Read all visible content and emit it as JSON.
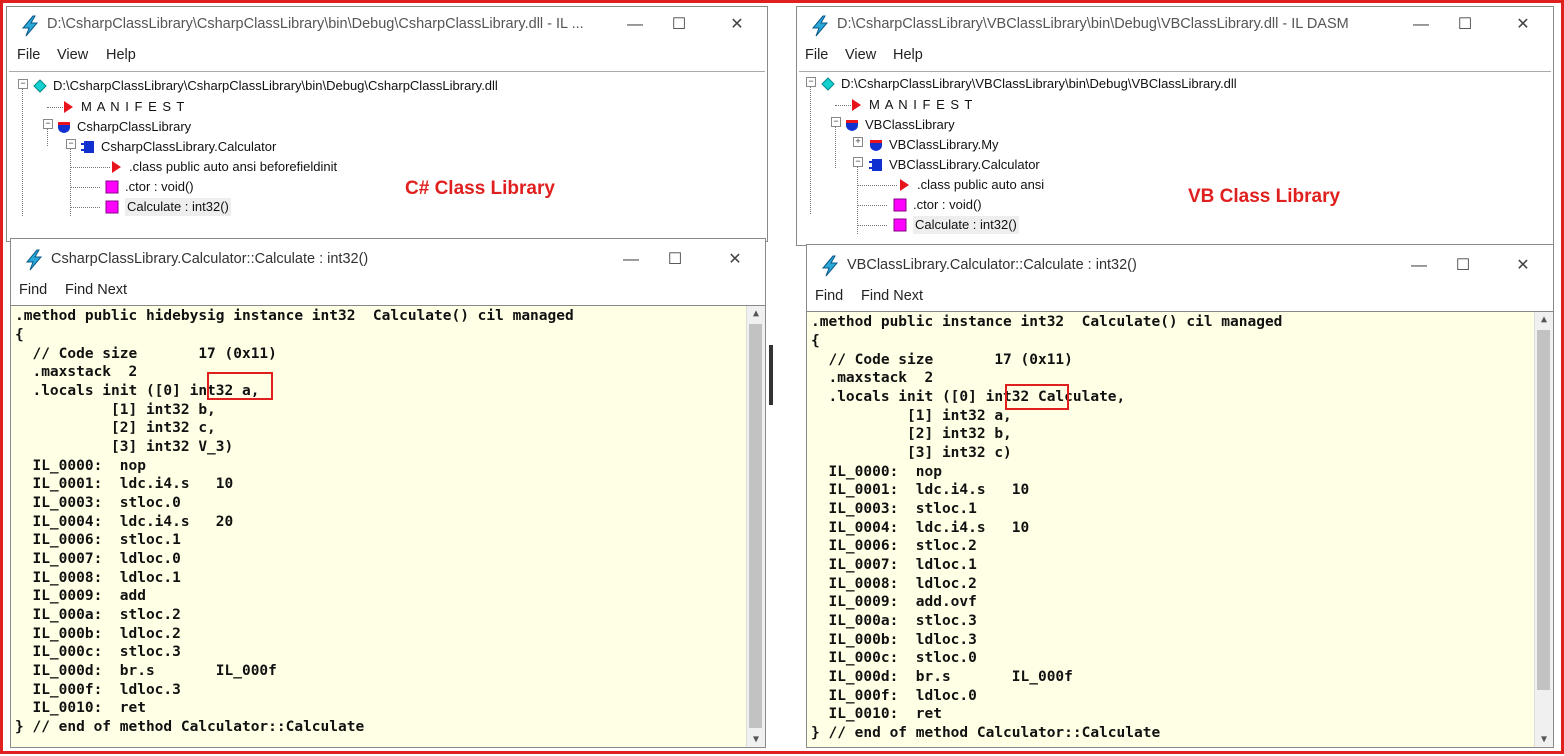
{
  "left": {
    "dasm_title": "D:\\CsharpClassLibrary\\CsharpClassLibrary\\bin\\Debug\\CsharpClassLibrary.dll - IL ...",
    "menu": [
      "File",
      "View",
      "Help"
    ],
    "tree": {
      "root": "D:\\CsharpClassLibrary\\CsharpClassLibrary\\bin\\Debug\\CsharpClassLibrary.dll",
      "manifest": "M A N I F E S T",
      "namespace": "CsharpClassLibrary",
      "class": "CsharpClassLibrary.Calculator",
      "class_decl": ".class public auto ansi beforefieldinit",
      "ctor": ".ctor : void()",
      "method": "Calculate : int32()"
    },
    "annotation": "C# Class Library",
    "code_title": "CsharpClassLibrary.Calculator::Calculate : int32()",
    "code_menu": [
      "Find",
      "Find Next"
    ],
    "code_lines": [
      ".method public hidebysig instance int32  Calculate() cil managed",
      "{",
      "  // Code size       17 (0x11)",
      "  .maxstack  2",
      "  .locals init ([0] int32 a,",
      "           [1] int32 b,",
      "           [2] int32 c,",
      "           [3] int32 V_3)",
      "  IL_0000:  nop",
      "  IL_0001:  ldc.i4.s   10",
      "  IL_0003:  stloc.0",
      "  IL_0004:  ldc.i4.s   20",
      "  IL_0006:  stloc.1",
      "  IL_0007:  ldloc.0",
      "  IL_0008:  ldloc.1",
      "  IL_0009:  add",
      "  IL_000a:  stloc.2",
      "  IL_000b:  ldloc.2",
      "  IL_000c:  stloc.3",
      "  IL_000d:  br.s       IL_000f",
      "  IL_000f:  ldloc.3",
      "  IL_0010:  ret",
      "} // end of method Calculator::Calculate"
    ]
  },
  "right": {
    "dasm_title": "D:\\CsharpClassLibrary\\VBClassLibrary\\bin\\Debug\\VBClassLibrary.dll - IL DASM",
    "menu": [
      "File",
      "View",
      "Help"
    ],
    "tree": {
      "root": "D:\\CsharpClassLibrary\\VBClassLibrary\\bin\\Debug\\VBClassLibrary.dll",
      "manifest": "M A N I F E S T",
      "namespace": "VBClassLibrary",
      "my_ns": "VBClassLibrary.My",
      "class": "VBClassLibrary.Calculator",
      "class_decl": ".class public auto ansi",
      "ctor": ".ctor : void()",
      "method": "Calculate : int32()"
    },
    "annotation": "VB Class Library",
    "code_title": "VBClassLibrary.Calculator::Calculate : int32()",
    "code_menu": [
      "Find",
      "Find Next"
    ],
    "code_lines": [
      ".method public instance int32  Calculate() cil managed",
      "{",
      "  // Code size       17 (0x11)",
      "  .maxstack  2",
      "  .locals init ([0] int32 Calculate,",
      "           [1] int32 a,",
      "           [2] int32 b,",
      "           [3] int32 c)",
      "  IL_0000:  nop",
      "  IL_0001:  ldc.i4.s   10",
      "  IL_0003:  stloc.1",
      "  IL_0004:  ldc.i4.s   10",
      "  IL_0006:  stloc.2",
      "  IL_0007:  ldloc.1",
      "  IL_0008:  ldloc.2",
      "  IL_0009:  add.ovf",
      "  IL_000a:  stloc.3",
      "  IL_000b:  ldloc.3",
      "  IL_000c:  stloc.0",
      "  IL_000d:  br.s       IL_000f",
      "  IL_000f:  ldloc.0",
      "  IL_0010:  ret",
      "} // end of method Calculator::Calculate"
    ]
  },
  "window_controls": {
    "minimize": "—",
    "maximize": "☐",
    "close": "✕"
  },
  "colors": {
    "highlight": "#e0201f",
    "code_bg": "#ffffe6",
    "tree_red": "#e8141c",
    "tree_blue": "#1030d0",
    "tree_magenta": "#ff00ff",
    "tree_cyan": "#10c8c8"
  }
}
